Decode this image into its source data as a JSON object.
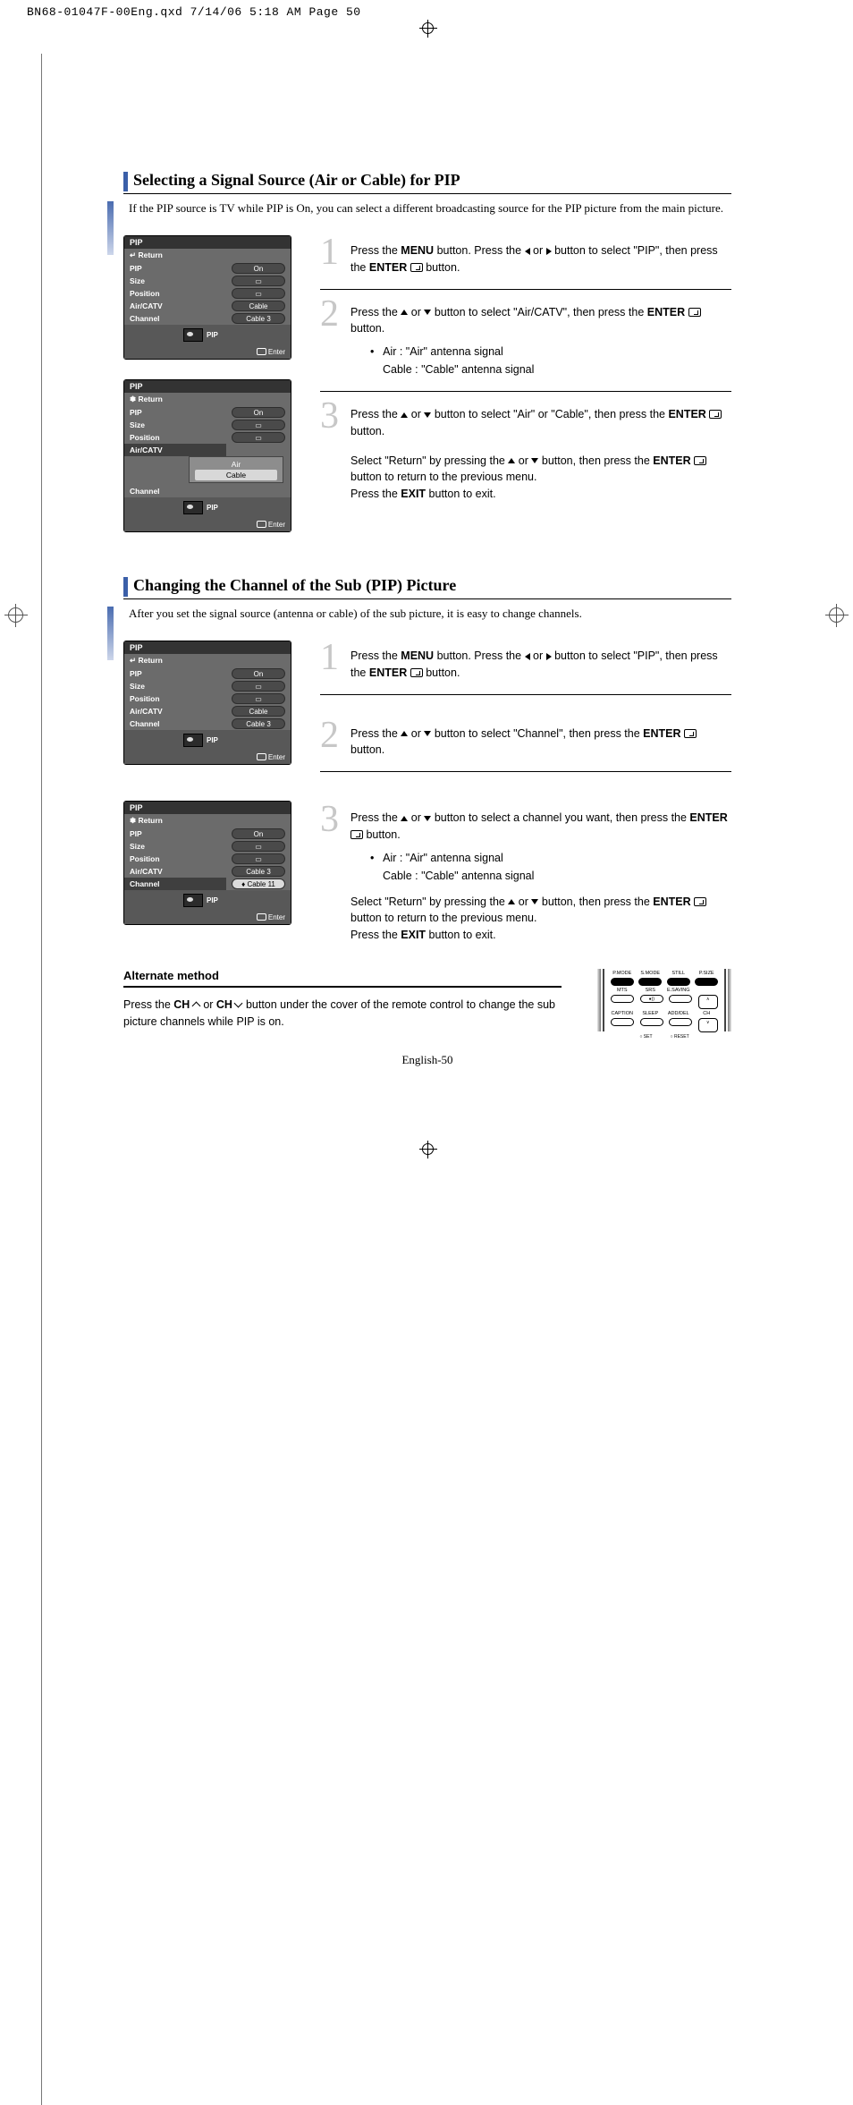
{
  "slug": "BN68-01047F-00Eng.qxd  7/14/06  5:18 AM  Page 50",
  "section1": {
    "title": "Selecting a Signal Source (Air or Cable) for PIP",
    "intro": "If the PIP source is TV while PIP is On, you can select a different broadcasting source for the PIP picture from the main picture."
  },
  "osd": {
    "title": "PIP",
    "return": "Return",
    "rows": {
      "pip": "PIP",
      "pip_v": "On",
      "size": "Size",
      "position": "Position",
      "aircatv": "Air/CATV",
      "aircatv_v": "Cable",
      "channel": "Channel",
      "channel_v": "Cable 3"
    },
    "drop": {
      "air": "Air",
      "cable": "Cable"
    },
    "channel_sel": "Cable 11",
    "footer_pip": "PIP",
    "footer_enter": "Enter"
  },
  "steps1": {
    "s1a": "Press the ",
    "s1b": "MENU",
    "s1c": " button. Press the ",
    "s1d": " or ",
    "s1e": " button to select \"PIP\", then press the ",
    "s1f": "ENTER",
    "s1g": " button.",
    "s2a": "Press the ",
    "s2b": " or ",
    "s2c": " button to select \"Air/CATV\", then press the ",
    "s2d": "ENTER",
    "s2e": " button.",
    "s2f": "Air : \"Air\" antenna signal",
    "s2g": "Cable : \"Cable\" antenna signal",
    "s3a": "Press the ",
    "s3b": " or ",
    "s3c": " button to select \"Air\" or \"Cable\", then press the ",
    "s3d": "ENTER",
    "s3e": " button.",
    "s3f": "Select \"Return\" by pressing the ",
    "s3g": " or ",
    "s3h": " button, then press the ",
    "s3i": "ENTER",
    "s3j": " button to return to the previous menu.",
    "s3k": "Press the ",
    "s3l": "EXIT",
    "s3m": " button to exit."
  },
  "section2": {
    "title": "Changing the Channel of the Sub (PIP) Picture",
    "intro": "After you set the signal source (antenna or cable) of the sub picture, it is easy to change channels."
  },
  "steps2": {
    "s2a": "Press the ",
    "s2b": " or ",
    "s2c": " button to select \"Channel\", then press the ",
    "s3a": "Press the ",
    "s3b": " or ",
    "s3c": " button to select a channel you want, then press the "
  },
  "alt": {
    "head": "Alternate method",
    "t1": "Press the ",
    "t2": "CH",
    "t3": " or ",
    "t4": "CH",
    "t5": " button under the cover of the remote control to change the sub picture channels while PIP is on."
  },
  "remote_labels": {
    "r1": [
      "P.MODE",
      "S.MODE",
      "STILL",
      "P.SIZE"
    ],
    "r2": [
      "MTS",
      "SRS",
      "E.SAVING",
      ""
    ],
    "r3": [
      "CAPTION",
      "SLEEP",
      "ADD/DEL",
      "CH"
    ],
    "r4": [
      "SET",
      "RESET"
    ]
  },
  "pgnum": "English-50"
}
